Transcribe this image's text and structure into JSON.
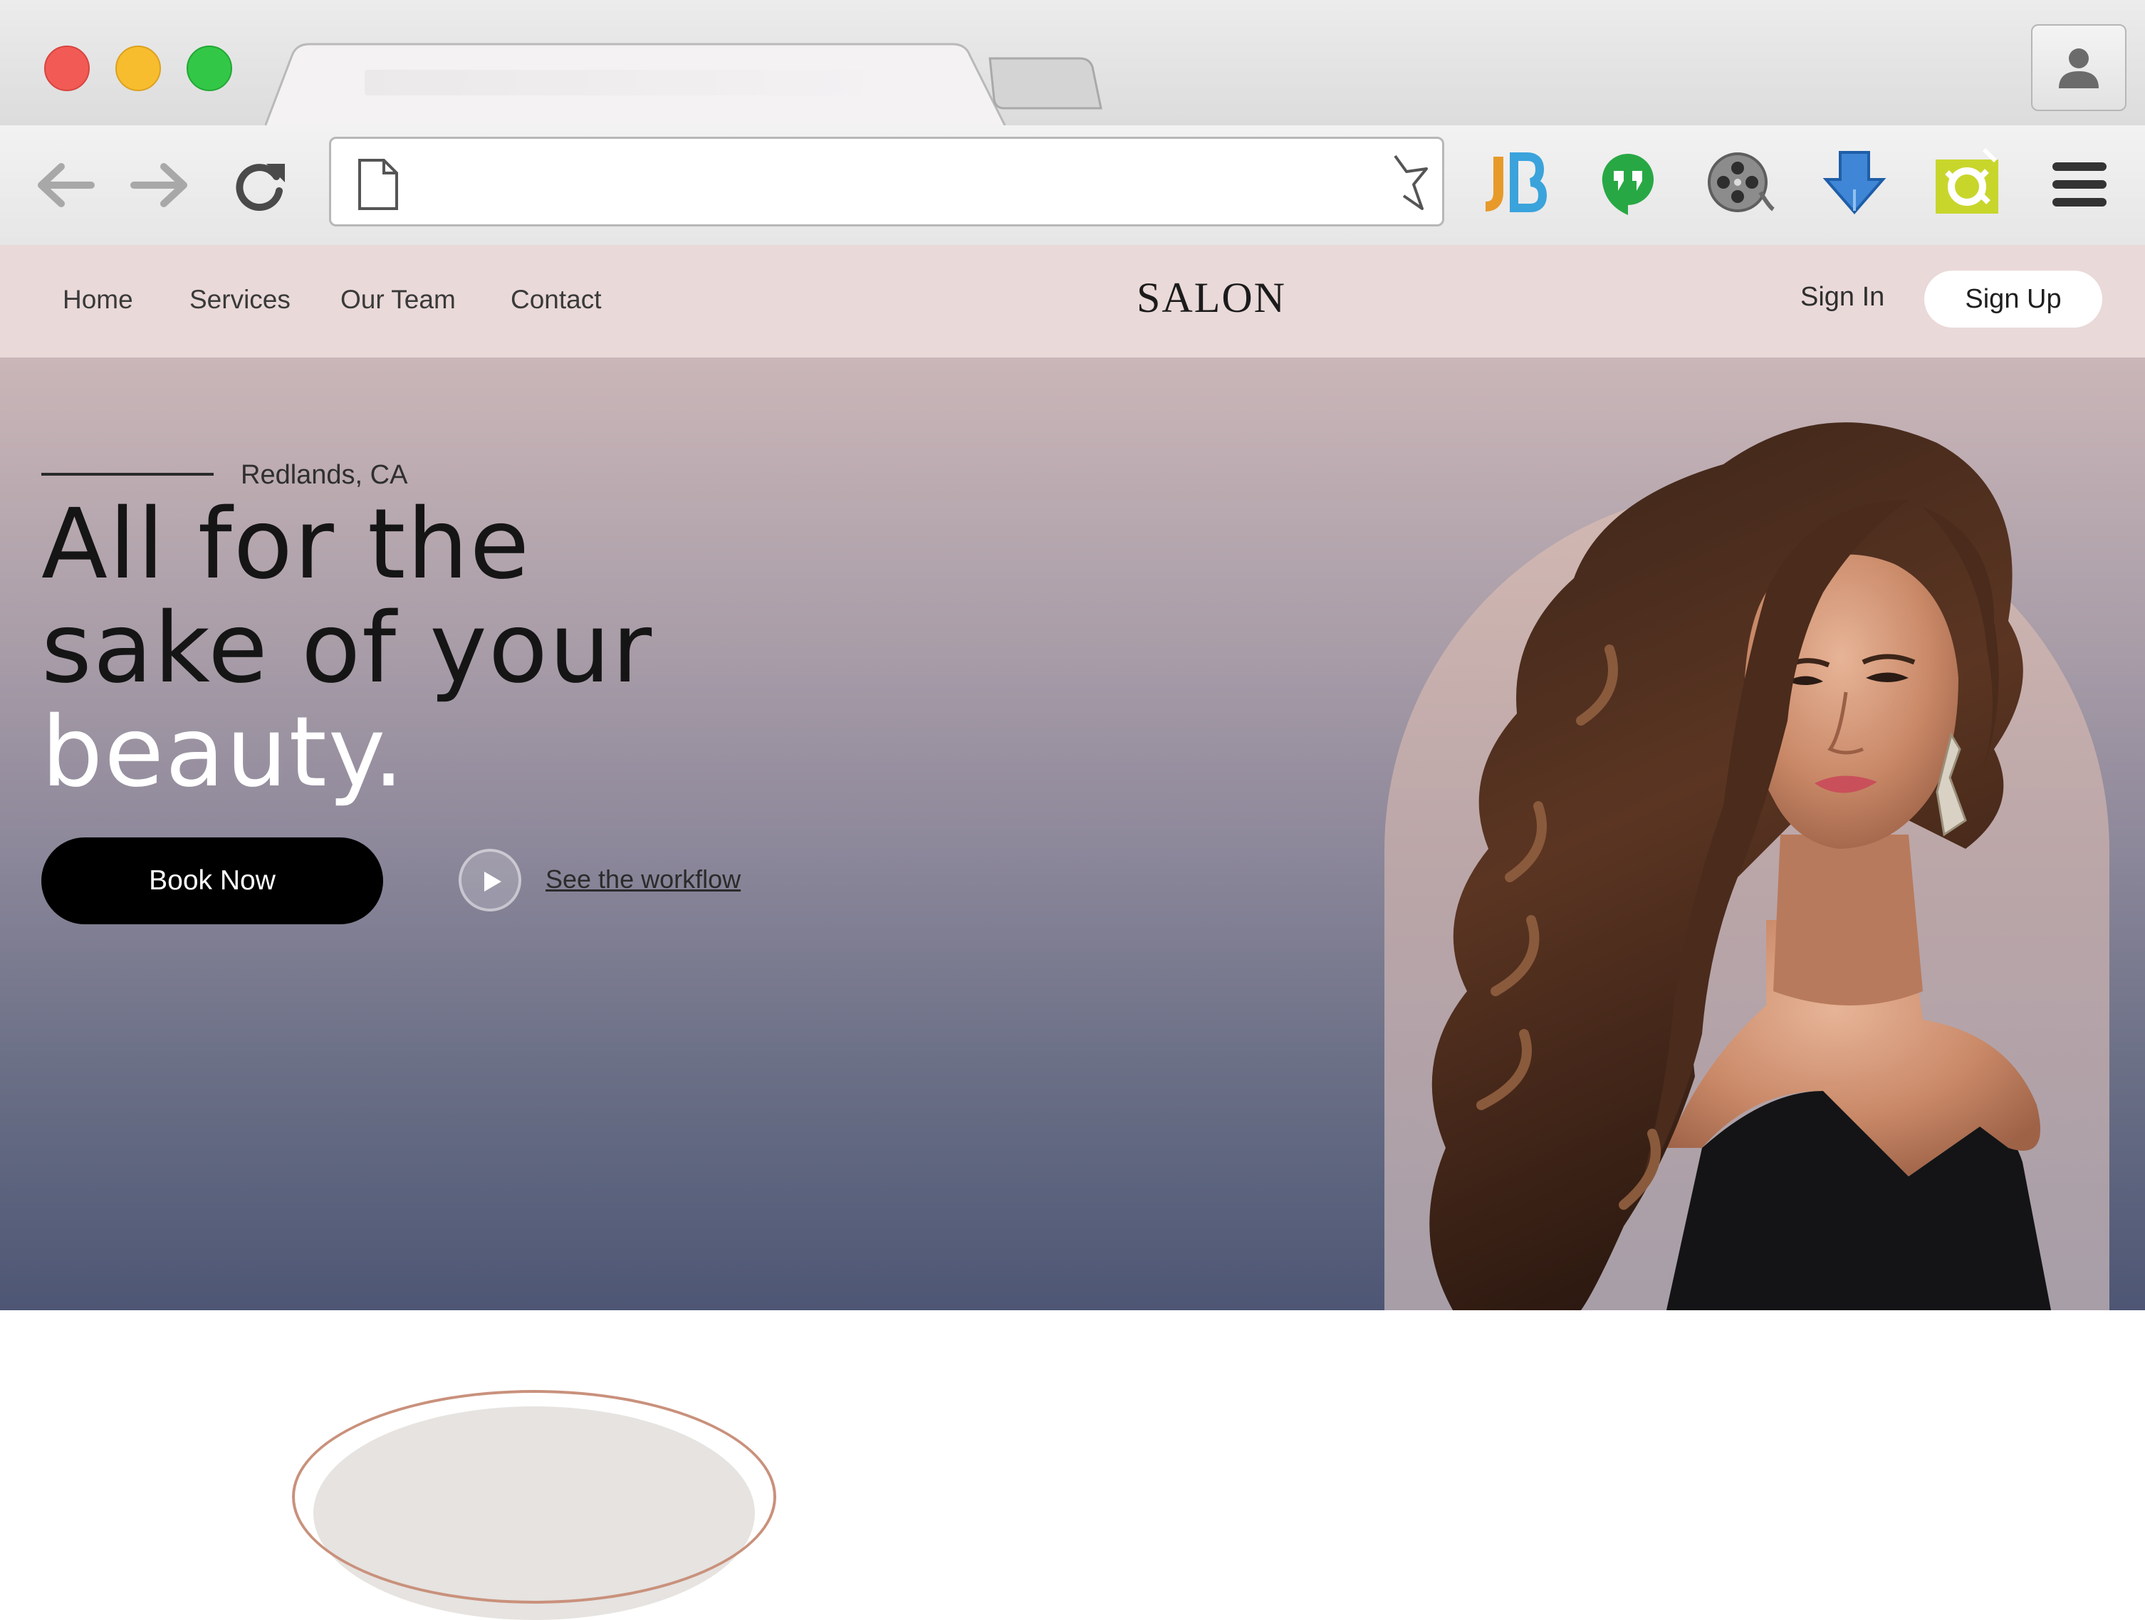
{
  "browser": {
    "tab_title": "",
    "address": "",
    "extensions": [
      "jetbrains-icon",
      "hangouts-icon",
      "film-reel-icon",
      "download-arrow-icon",
      "screenshot-icon"
    ]
  },
  "nav": {
    "links": [
      "Home",
      "Services",
      "Our Team",
      "Contact"
    ],
    "logo": "SALON",
    "sign_in": "Sign In",
    "sign_up": "Sign Up"
  },
  "hero": {
    "location": "Redlands, CA",
    "headline_line1": "All for the",
    "headline_line2": "sake of your",
    "headline_line3": "beauty.",
    "book_button": "Book Now",
    "workflow_link": "See the workflow"
  },
  "colors": {
    "nav_bg": "#ead9d9",
    "hero_top": "#cab6b8",
    "hero_bottom": "#4d5674",
    "button": "#000000",
    "accent_arc": "#c9917c"
  }
}
